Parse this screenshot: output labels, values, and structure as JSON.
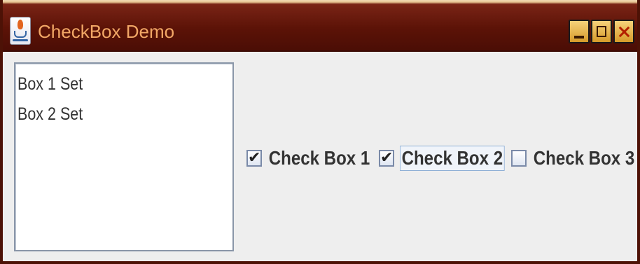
{
  "window": {
    "title": "CheckBox Demo",
    "icon": "java-cup-icon",
    "controls": [
      "minimize-icon",
      "maximize-icon",
      "close-icon"
    ],
    "colors": {
      "titlebar": "#5c1307",
      "title_text": "#f2a766",
      "control_buttons": "#e7b54a",
      "body": "#eeeeee"
    }
  },
  "textarea": {
    "lines": [
      "Box 1 Set",
      "Box 2 Set"
    ]
  },
  "checkboxes": [
    {
      "label": "Check Box 1",
      "checked": true,
      "focused": false
    },
    {
      "label": "Check Box 2",
      "checked": true,
      "focused": true
    },
    {
      "label": "Check Box 3",
      "checked": false,
      "focused": false
    }
  ]
}
